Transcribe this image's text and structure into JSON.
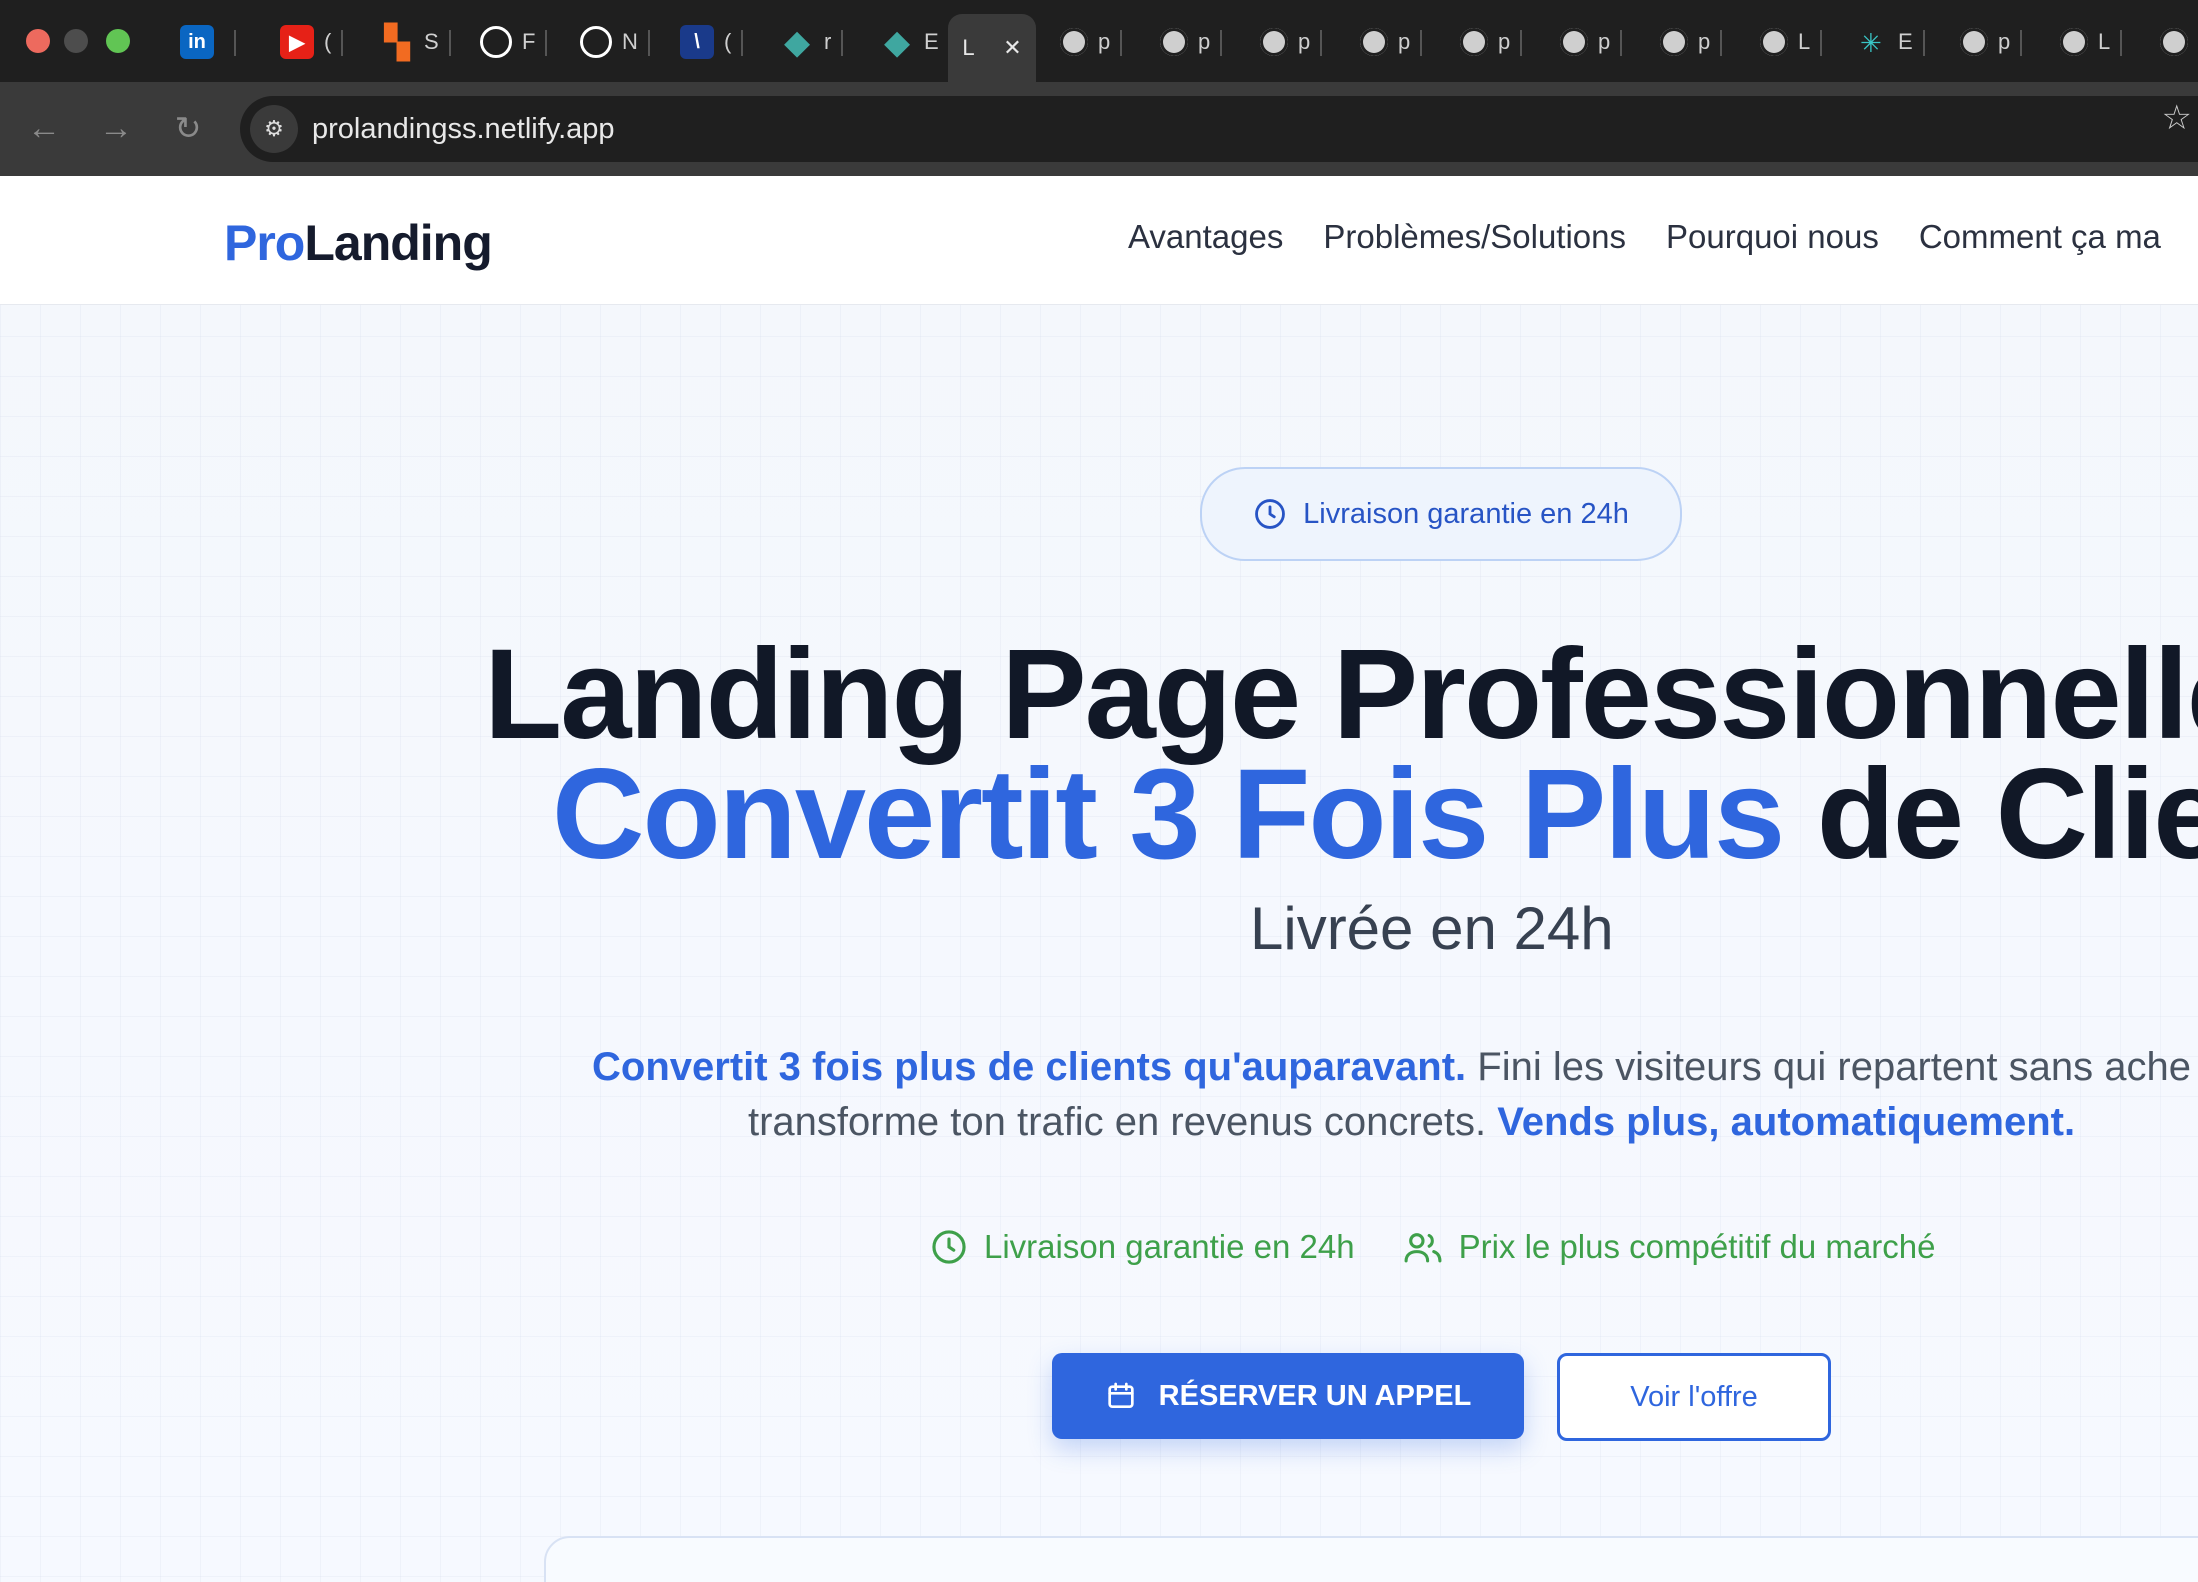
{
  "browser": {
    "url": "prolandingss.netlify.app",
    "tabs": [
      {
        "icon": "linkedin-icon",
        "glyph": "in",
        "color": "#0a66c2",
        "label": ""
      },
      {
        "icon": "youtube-icon",
        "glyph": "▶",
        "color": "#e62117",
        "label": "("
      },
      {
        "icon": "orange-app-icon",
        "glyph": "▚",
        "color": "#f26b21",
        "label": "S"
      },
      {
        "icon": "github-icon",
        "glyph": "●",
        "color": "#ffffff",
        "label": "F"
      },
      {
        "icon": "github-icon",
        "glyph": "●",
        "color": "#ffffff",
        "label": "N"
      },
      {
        "icon": "slash-app-icon",
        "glyph": "\\",
        "color": "#1a3a8a",
        "label": "("
      },
      {
        "icon": "diamond-icon",
        "glyph": "◆",
        "color": "#3fa7a0",
        "label": "r"
      },
      {
        "icon": "diamond-icon",
        "glyph": "◆",
        "color": "#3fa7a0",
        "label": "E"
      }
    ],
    "active_tab": {
      "label": "L",
      "close": "✕"
    },
    "globe_tabs": [
      "p",
      "p",
      "p",
      "p",
      "p",
      "p",
      "p",
      "L",
      "E",
      "p",
      "L",
      ""
    ]
  },
  "nav": {
    "logo_pro": "Pro",
    "logo_landing": "Landing",
    "links": [
      "Avantages",
      "Problèmes/Solutions",
      "Pourquoi nous",
      "Comment ça ma"
    ]
  },
  "hero": {
    "badge": "Livraison garantie en 24h",
    "title_line1": "Landing Page Professionnelle",
    "title_line2_blue": "Convertit 3 Fois Plus",
    "title_line2_dark": "de Clien",
    "subtitle": "Livrée en 24h",
    "para_line1_hl": "Convertit 3 fois plus de clients qu'auparavant.",
    "para_line1_rest": "Fini les visiteurs qui repartent sans ache",
    "para_line2_rest": "transforme ton trafic en revenus concrets.",
    "para_line2_hl": "Vends plus, automatiquement.",
    "features": [
      "Livraison garantie en 24h",
      "Prix le plus compétitif du marché"
    ],
    "cta_primary": "RÉSERVER UN APPEL",
    "cta_secondary": "Voir l'offre"
  },
  "colors": {
    "accent": "#2f66de",
    "feature_green": "#3ea04a",
    "heading": "#111827"
  }
}
